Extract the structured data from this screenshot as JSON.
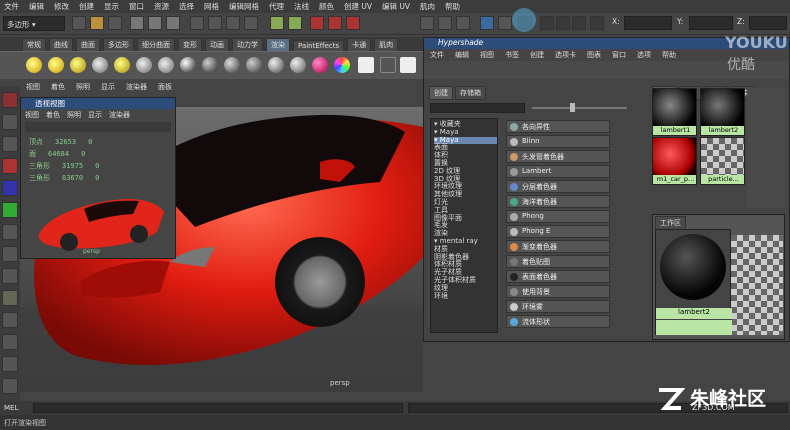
{
  "menubar": [
    "文件",
    "编辑",
    "修改",
    "创建",
    "显示",
    "窗口",
    "资源",
    "选择",
    "网格",
    "编辑网格",
    "代理",
    "法线",
    "颜色",
    "创建 UV",
    "编辑 UV",
    "肌肉",
    "帮助"
  ],
  "status": {
    "mode": "多边形",
    "x_label": "X:",
    "y_label": "Y:",
    "z_label": "Z:"
  },
  "shelf_tabs": [
    "常规",
    "曲线",
    "曲面",
    "多边形",
    "细分曲面",
    "变形",
    "动画",
    "动力学",
    "渲染",
    "PaintEffects",
    "卡通",
    "肌肉"
  ],
  "shelf_active": 8,
  "viewport_menu": [
    "视图",
    "着色",
    "照明",
    "显示",
    "渲染器",
    "面板"
  ],
  "persp": {
    "title": "透视视图",
    "menu": [
      "视图",
      "着色",
      "照明",
      "显示",
      "渲染器"
    ],
    "stats": [
      [
        "顶点",
        "32653",
        "0"
      ],
      [
        "面",
        "64684",
        "0"
      ],
      [
        "三角形",
        "31975",
        "0"
      ],
      [
        "三角形",
        "63670",
        "0"
      ]
    ],
    "label": "persp"
  },
  "hypershade": {
    "title": "Hypershade",
    "menu": [
      "文件",
      "编辑",
      "视图",
      "书签",
      "创建",
      "选项卡",
      "图表",
      "窗口",
      "选项",
      "帮助"
    ],
    "left_tabs": [
      "创建",
      "存储箱"
    ],
    "tree": [
      {
        "t": "▾ 收藏夹",
        "sel": false
      },
      {
        "t": "  ▾ Maya",
        "sel": false
      },
      {
        "t": "▾ Maya",
        "sel": true
      },
      {
        "t": "   表面",
        "sel": false
      },
      {
        "t": "   体积",
        "sel": false
      },
      {
        "t": "   置换",
        "sel": false
      },
      {
        "t": "   2D 纹理",
        "sel": false
      },
      {
        "t": "   3D 纹理",
        "sel": false
      },
      {
        "t": "   环境纹理",
        "sel": false
      },
      {
        "t": "   其他纹理",
        "sel": false
      },
      {
        "t": "   灯光",
        "sel": false
      },
      {
        "t": "   工具",
        "sel": false
      },
      {
        "t": "   图像平面",
        "sel": false
      },
      {
        "t": "   毛发",
        "sel": false
      },
      {
        "t": "   渲染",
        "sel": false
      },
      {
        "t": "▾ mental ray",
        "sel": false
      },
      {
        "t": "   材质",
        "sel": false
      },
      {
        "t": "   阴影着色器",
        "sel": false
      },
      {
        "t": "   体积材质",
        "sel": false
      },
      {
        "t": "   光子材质",
        "sel": false
      },
      {
        "t": "   光子体积材质",
        "sel": false
      },
      {
        "t": "   纹理",
        "sel": false
      },
      {
        "t": "   环境",
        "sel": false
      }
    ],
    "nodes": [
      {
        "label": "各向异性",
        "color": "#8aa"
      },
      {
        "label": "Blinn",
        "color": "#bbb"
      },
      {
        "label": "头发管着色器",
        "color": "#c96"
      },
      {
        "label": "Lambert",
        "color": "#999"
      },
      {
        "label": "分层着色器",
        "color": "#68c"
      },
      {
        "label": "海洋着色器",
        "color": "#4a8"
      },
      {
        "label": "Phong",
        "color": "#aaa"
      },
      {
        "label": "Phong E",
        "color": "#bbb"
      },
      {
        "label": "渐变着色器",
        "color": "#d84"
      },
      {
        "label": "着色贴图",
        "color": "#777"
      },
      {
        "label": "表面着色器",
        "color": "#222"
      },
      {
        "label": "使用背景",
        "color": "#888"
      },
      {
        "label": "环境雾",
        "color": "#ccc"
      },
      {
        "label": "流体形状",
        "color": "#5ad"
      }
    ],
    "right_tabs": [
      "材质",
      "纹理",
      "工具",
      "渲染"
    ],
    "swatches": [
      "lambert1",
      "lambert2",
      "m1_car_p...",
      "particle..."
    ],
    "work_tab": "工作区",
    "work_node": "lambert2"
  },
  "cmd_label": "MEL",
  "help_text": "打开渲染视图",
  "watermark": {
    "youku": "YOUKU",
    "youku_cn": "优酷",
    "brand": "朱峰社区",
    "brand_url": "ZF3D.COM"
  }
}
